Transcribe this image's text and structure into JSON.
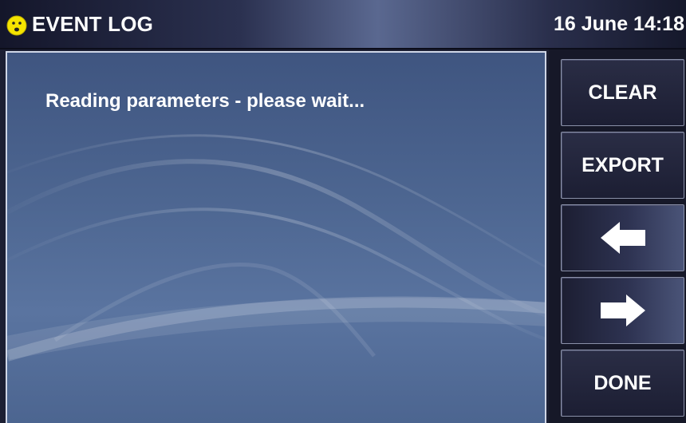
{
  "header": {
    "title": "EVENT LOG",
    "datetime": "16 June 14:18",
    "status_icon": "smiley-icon"
  },
  "main": {
    "status_message": "Reading parameters - please wait..."
  },
  "buttons": {
    "clear_label": "CLEAR",
    "export_label": "EXPORT",
    "prev_icon": "arrow-left-icon",
    "next_icon": "arrow-right-icon",
    "done_label": "DONE"
  },
  "colors": {
    "header_bg": "#2b3150",
    "panel_bg": "#4d6691",
    "button_bg": "#1c1e33",
    "text": "#ffffff",
    "smiley": "#f5e400"
  }
}
